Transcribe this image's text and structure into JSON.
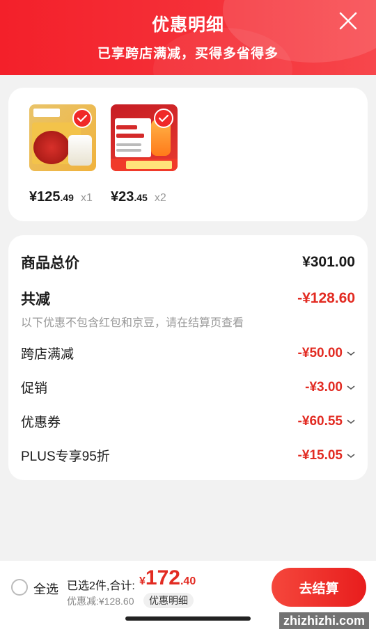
{
  "header": {
    "title": "优惠明细",
    "subtitle": "已享跨店满减，买得多省得多"
  },
  "products": [
    {
      "price_int": "¥125",
      "price_dec": ".49",
      "qty": "x1"
    },
    {
      "price_int": "¥23",
      "price_dec": ".45",
      "qty": "x2"
    }
  ],
  "summary": {
    "total_label": "商品总价",
    "total_value": "¥301.00",
    "reduce_label": "共减",
    "reduce_value": "-¥128.60",
    "note": "以下优惠不包含红包和京豆，请在结算页查看",
    "items": [
      {
        "label": "跨店满减",
        "value": "-¥50.00"
      },
      {
        "label": "促销",
        "value": "-¥3.00"
      },
      {
        "label": "优惠券",
        "value": "-¥60.55"
      },
      {
        "label": "PLUS专享95折",
        "value": "-¥15.05"
      }
    ]
  },
  "bottom": {
    "select_all": "全选",
    "selected_text": "已选2件,合计:",
    "price_yen": "¥",
    "price_int": "172",
    "price_dec": ".40",
    "discount": "优惠减:¥128.60",
    "detail_btn": "优惠明细",
    "checkout": "去结算"
  },
  "watermark": "zhizhizhi.com",
  "colors": {
    "accent": "#e22b22",
    "header": "#f3202a"
  }
}
